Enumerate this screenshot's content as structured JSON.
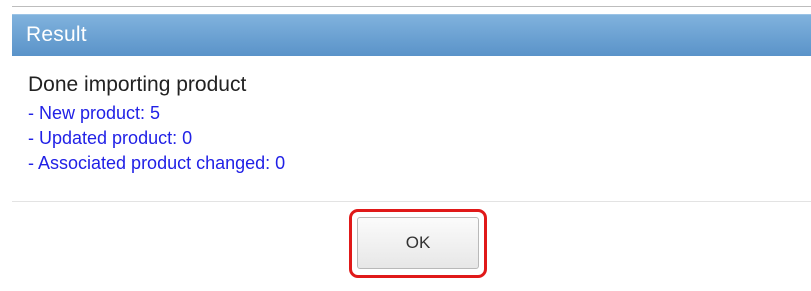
{
  "dialog": {
    "title": "Result",
    "message": "Done importing product",
    "details": [
      "- New product: 5",
      "- Updated product: 0",
      "- Associated product changed: 0"
    ],
    "ok_label": "OK"
  },
  "colors": {
    "titlebar": "#6aa3d5",
    "details_text": "#2121e6",
    "highlight": "#e01919"
  }
}
